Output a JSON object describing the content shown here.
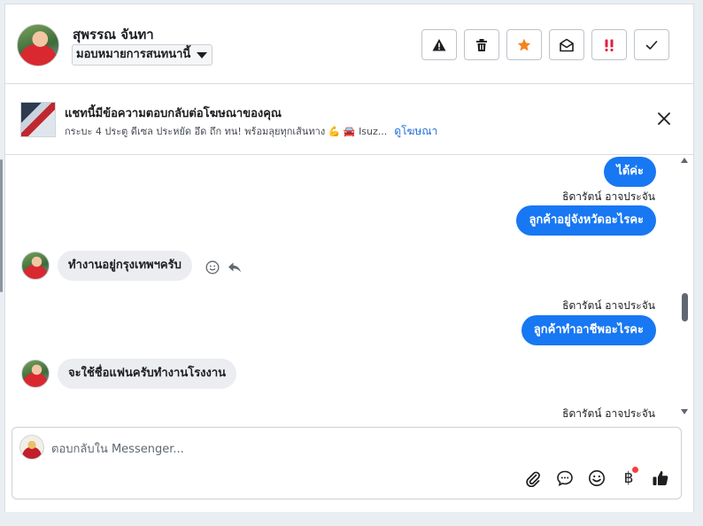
{
  "header": {
    "contact_name": "สุพรรณ จันทา",
    "assign_label": "มอบหมายการสนทนานี้"
  },
  "ad": {
    "title": "แชทนี้มีข้อความตอบกลับต่อโฆษณาของคุณ",
    "subtitle": "กระบะ 4 ประตู ดีเซล ประหยัด อึด ถึก ทน! พร้อมลุยทุกเส้นทาง 💪 🚘 Isuz...",
    "link": "ดูโฆษณา"
  },
  "messages": [
    {
      "dir": "out",
      "text": "ได้ค่ะ"
    },
    {
      "dir": "out",
      "sender": "ธิดารัตน์ อาจประจัน",
      "text": "ลูกค้าอยู่จังหวัดอะไรคะ"
    },
    {
      "dir": "in",
      "text": "ทำงานอยู่กรุงเทพฯครับ"
    },
    {
      "dir": "out",
      "sender": "ธิดารัตน์ อาจประจัน",
      "text": "ลูกค้าทำอาชีพอะไรคะ"
    },
    {
      "dir": "in",
      "text": "จะใช้ชื่อแฟนครับทำงานโรงงาน"
    },
    {
      "dir": "out",
      "sender": "ธิดารัตน์ อาจประจัน",
      "text": ""
    }
  ],
  "composer": {
    "placeholder": "ตอบกลับใน Messenger..."
  },
  "icons": {
    "baht": "฿"
  },
  "colors": {
    "accent": "#1877f2",
    "star": "#f5821f",
    "urgent": "#e41e3f"
  }
}
